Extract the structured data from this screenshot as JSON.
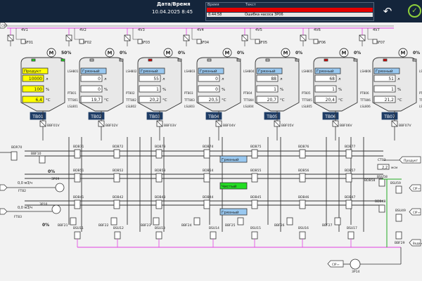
{
  "header": {
    "datetime_label": "Дата/Время",
    "datetime_value": "10.04.2025 8:45"
  },
  "alarms": {
    "col_time": "Время",
    "col_text": "Текст",
    "rows": [
      {
        "time": "",
        "text": "",
        "color": "#e60000"
      },
      {
        "time": "8:44:58",
        "text": "Ошибка насоса ЗР06",
        "color": "#e5e5e5"
      }
    ]
  },
  "actions": {
    "back_icon": "undo-arrow-icon",
    "confirm_icon": "check-circle-icon"
  },
  "colors": {
    "pipe_magenta": "#e040e0",
    "pipe_dark": "#333333",
    "tank_label_bg": "#1f3d66",
    "dirty_bg": "#99c8f0",
    "product_bg": "#ffff00",
    "clean_bg": "#22dd22"
  },
  "tanks": [
    {
      "name": "TB01",
      "state": "Продукт",
      "level": "10000",
      "level_unit": "л",
      "percent": "100",
      "temp": "6,4",
      "temp_unit": "°С",
      "pct_unit": "%",
      "valve": "4V1",
      "outlet": "BBF01V",
      "top": "BBF01",
      "lsh": "LSH801",
      "ptt": "PT801",
      "ttt": "TTT801",
      "lsl": "LSL801",
      "state_type": "product",
      "motor": "50%",
      "led": "on"
    },
    {
      "name": "TB02",
      "state": "Грязный",
      "level": "0",
      "level_unit": "л",
      "percent": "0",
      "temp": "19,7",
      "temp_unit": "°С",
      "pct_unit": "%",
      "valve": "4V2",
      "outlet": "BBF02V",
      "top": "BBF02",
      "lsh": "LSH802",
      "ptt": "PT802",
      "ttt": "TTT802",
      "lsl": "LSL802",
      "state_type": "dirty",
      "motor": "0%",
      "led": "off"
    },
    {
      "name": "TB03",
      "state": "Грязный",
      "level": "55",
      "level_unit": "л",
      "percent": "1",
      "temp": "20,2",
      "temp_unit": "°С",
      "pct_unit": "%",
      "valve": "4V3",
      "outlet": "BBF03V",
      "top": "BBF03",
      "lsh": "LSH803",
      "ptt": "PT803",
      "ttt": "TTT803",
      "lsl": "LSL803",
      "state_type": "dirty",
      "motor": "0%",
      "led": "red"
    },
    {
      "name": "TB04",
      "state": "Грязный",
      "level": "0",
      "level_unit": "л",
      "percent": "0",
      "temp": "20,5",
      "temp_unit": "°С",
      "pct_unit": "%",
      "valve": "4V4",
      "outlet": "BBF04V",
      "top": "BBF04",
      "lsh": "LSH804",
      "ptt": "PT804",
      "ttt": "TTT804",
      "lsl": "LSL804",
      "state_type": "dirty",
      "motor": "0%",
      "led": "off"
    },
    {
      "name": "TB05",
      "state": "Грязный",
      "level": "88",
      "level_unit": "л",
      "percent": "1",
      "temp": "20,7",
      "temp_unit": "°С",
      "pct_unit": "%",
      "valve": "4V5",
      "outlet": "BBF05V",
      "top": "BBF05",
      "lsh": "LSH805",
      "ptt": "PT805",
      "ttt": "TTT805",
      "lsl": "LSL805",
      "state_type": "dirty",
      "motor": "0%",
      "led": "off"
    },
    {
      "name": "TB06",
      "state": "Грязный",
      "level": "68",
      "level_unit": "л",
      "percent": "1",
      "temp": "20,4",
      "temp_unit": "°С",
      "pct_unit": "%",
      "valve": "4V6",
      "outlet": "BBF06V",
      "top": "BBF06",
      "lsh": "LSH806",
      "ptt": "PT806",
      "ttt": "TTT806",
      "lsl": "LSL806",
      "state_type": "dirty",
      "motor": "0%",
      "led": "red"
    },
    {
      "name": "TB07",
      "state": "Грязный",
      "level": "51",
      "level_unit": "л",
      "percent": "1",
      "temp": "21,2",
      "temp_unit": "°С",
      "pct_unit": "%",
      "valve": "4V7",
      "outlet": "BBF07V",
      "top": "BBF07",
      "lsh": "LSH807",
      "ptt": "PT807",
      "ttt": "TTT807",
      "lsl": "LSL807",
      "state_type": "dirty",
      "motor": "0%",
      "led": "red"
    }
  ],
  "inlet_arrow": "CIP",
  "matrix": {
    "row1": [
      "BDB71",
      "BDB72",
      "BDB73",
      "BDB74",
      "BDB75",
      "BDB76",
      "BDB77"
    ],
    "row2": [
      "BDB51",
      "BDB52",
      "BDB53",
      "BDB54",
      "BDB55",
      "BDB56",
      "BDB57"
    ],
    "row3": [
      "BDB41",
      "BDB42",
      "BDB43",
      "BDB44",
      "BDB45",
      "BDB46",
      "BDB47"
    ],
    "bottom": [
      "BBF21",
      "BBF22",
      "BBF23",
      "BBF24",
      "BBF25",
      "BBF26",
      "BBF27"
    ],
    "bsu": [
      "BSU11",
      "BSU12",
      "BSU13",
      "BSU14",
      "BSU15",
      "BSU16",
      "BSU17"
    ]
  },
  "lines": [
    {
      "state": "Грязный",
      "type": "dirty"
    },
    {
      "state": "Чистый",
      "type": "clean"
    },
    {
      "state": "Грязный",
      "type": "dirty"
    }
  ],
  "left": {
    "bdr70": "BDR70",
    "bbf10": "BBF10",
    "ft82_label": "FT82",
    "ft82_value": "0,0",
    "ft82_unit": "м3/ч",
    "pump1": "3P09",
    "pump1_pct": "0%",
    "ft83_label": "FT83",
    "ft83_value": "0,0",
    "ft83_unit": "м3/ч",
    "pump2": "3P10",
    "pump2_pct": "0%"
  },
  "right": {
    "ct03": "CT03",
    "ct03_value": "2,2",
    "ct03_unit": "мсм",
    "product": "Продукт",
    "bdb58": "BDB58",
    "bsu58": "BSU58",
    "bsu59": "BSU59",
    "bdb48": "BDB48",
    "bsu49": "BSU49",
    "bbf29": "BBF29",
    "cip_out1": "CIP ←",
    "cip_out2": "CIP ←",
    "voda": "Вода ←",
    "cip_return": "CIP ←",
    "pump3": "3P14"
  }
}
